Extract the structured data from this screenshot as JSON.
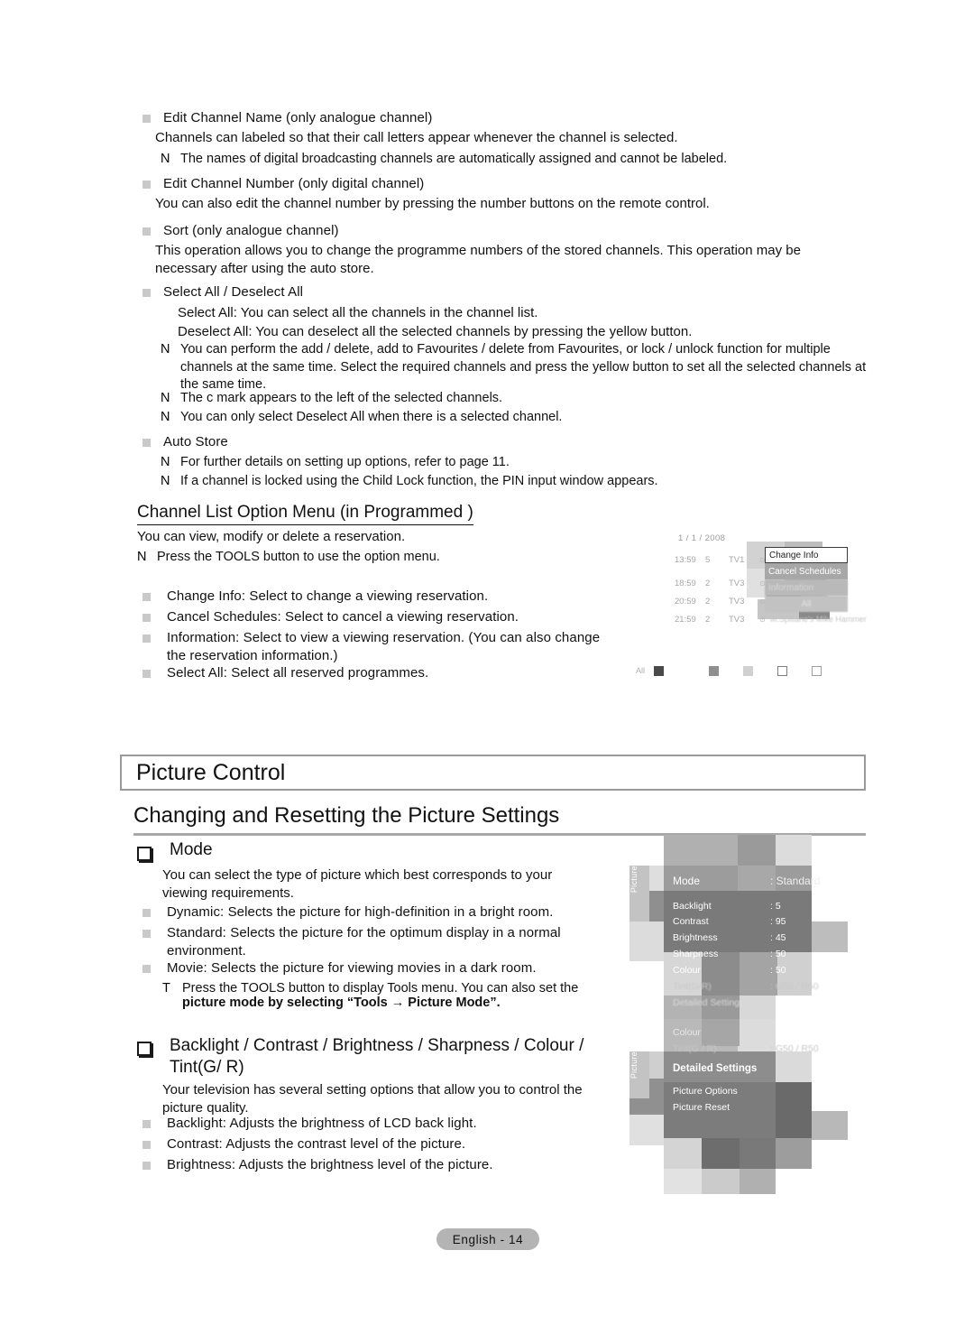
{
  "document": {
    "footer_label": "English - 14"
  },
  "channel_section": {
    "blocks": [
      {
        "bullet": "square",
        "heading": "Edit Channel Name (only analogue channel)",
        "body": "Channels can labeled so that their call letters appear whenever the channel is selected.",
        "note_mark": "N",
        "note": "The names of digital broadcasting channels are automatically assigned and cannot be labeled."
      },
      {
        "bullet": "square",
        "heading": "Edit Channel Number (only digital channel)",
        "body": "You can also edit the channel number by pressing the number buttons on the remote control."
      },
      {
        "bullet": "square",
        "heading": "Sort (only analogue channel)",
        "body": "This operation allows you to change the programme numbers of the stored channels. This operation may be necessary after using the auto store."
      }
    ],
    "select_all": {
      "heading": "Select All / Deselect All",
      "line1": "Select All: You can select all the channels in the channel list.",
      "line2": "Deselect All: You can deselect all the selected channels by pressing the yellow button.",
      "notes": [
        "You can perform the add / delete, add to Favourites / delete from Favourites, or lock / unlock function for multiple channels at the same time. Select the required channels and press the yellow button to set all the selected channels at the same time.",
        "The c mark appears to the left of the selected channels.",
        "You can only select  Deselect All  when there is a selected channel."
      ]
    },
    "auto_store": {
      "heading": "Auto Store",
      "notes": [
        "For further details on setting up options, refer to page 11.",
        "If a channel is locked using the  Child Lock  function, the PIN input window appears."
      ]
    }
  },
  "option_menu": {
    "title": "Channel List Option Menu (in Programmed )",
    "intro": "You can view, modify or delete a reservation.",
    "note_mark": "N",
    "note": "Press the TOOLS button to use the option menu.",
    "items": [
      "Change Info: Select to change a viewing reservation.",
      "Cancel Schedules: Select to cancel a viewing reservation.",
      "Information: Select to view a viewing reservation. (You can also change the reservation information.)",
      "Select All: Select all reserved programmes."
    ]
  },
  "schedule_screenshot": {
    "date": "1 / 1 / 2008",
    "rows": [
      {
        "time": "13:59",
        "channel": "5",
        "name": "TV1",
        "clock": "⊙",
        "programme": ""
      },
      {
        "time": "18:59",
        "channel": "2",
        "name": "TV3",
        "clock": "⊙",
        "programme": ""
      },
      {
        "time": "20:59",
        "channel": "2",
        "name": "TV3",
        "clock": "⊙",
        "programme": ""
      },
      {
        "time": "21:59",
        "channel": "2",
        "name": "TV3",
        "clock": "⊙",
        "programme": "M.Spillane's Mike Hammer"
      }
    ],
    "popup": {
      "items": [
        "Change Info",
        "Cancel Schedules",
        "Information",
        "All"
      ],
      "selected": "Change Info"
    },
    "bottom_bar_label": "All"
  },
  "picture_control": {
    "chapter_title": "Picture Control",
    "section_title": "Changing and Resetting the Picture Settings",
    "mode": {
      "heading": "Mode",
      "body": "You can select the type of picture which best corresponds to your viewing requirements.",
      "items": [
        "Dynamic: Selects the picture for high-definition in a bright room.",
        "Standard: Selects the picture for the optimum display in a normal environment.",
        "Movie: Selects the picture for viewing movies in a dark room."
      ],
      "tools_mark": "T",
      "tools_note_part1": "Press the TOOLS button to display  Tools  menu. You can also set the ",
      "tools_note_part2": "picture mode by selecting “Tools → Picture Mode”."
    },
    "backlight": {
      "heading": "Backlight / Contrast / Brightness / Sharpness / Colour / Tint(G/ R)",
      "body": "Your television has several setting options that allow you to control the picture quality.",
      "items": [
        "Backlight: Adjusts the brightness of LCD back light.",
        "Contrast: Adjusts the contrast level of the picture.",
        "Brightness: Adjusts the brightness level of the picture."
      ]
    }
  },
  "picture_menu_screenshot": {
    "sidebar_label": "Picture",
    "rows": [
      {
        "key": "Mode",
        "value": ": Standard"
      },
      {
        "key": "Backlight",
        "value": ": 5"
      },
      {
        "key": "Contrast",
        "value": ": 95"
      },
      {
        "key": "Brightness",
        "value": ": 45"
      },
      {
        "key": "Sharpness",
        "value": ": 50"
      },
      {
        "key": "Colour",
        "value": ": 50"
      },
      {
        "key": "Tint(G/R)",
        "value": ": G50 / R50"
      },
      {
        "key": "Detailed Settings",
        "value": ""
      }
    ]
  },
  "picture_menu_screenshot2": {
    "sidebar_label": "Picture",
    "rows": [
      {
        "key": "Colour",
        "value": ":"
      },
      {
        "key": "Tint(G / R)",
        "value": ": G50 / R50"
      },
      {
        "key": "Detailed Settings",
        "value": ""
      },
      {
        "key": "Picture Options",
        "value": ""
      },
      {
        "key": "Picture Reset",
        "value": ""
      }
    ],
    "highlighted": "Detailed Settings"
  }
}
